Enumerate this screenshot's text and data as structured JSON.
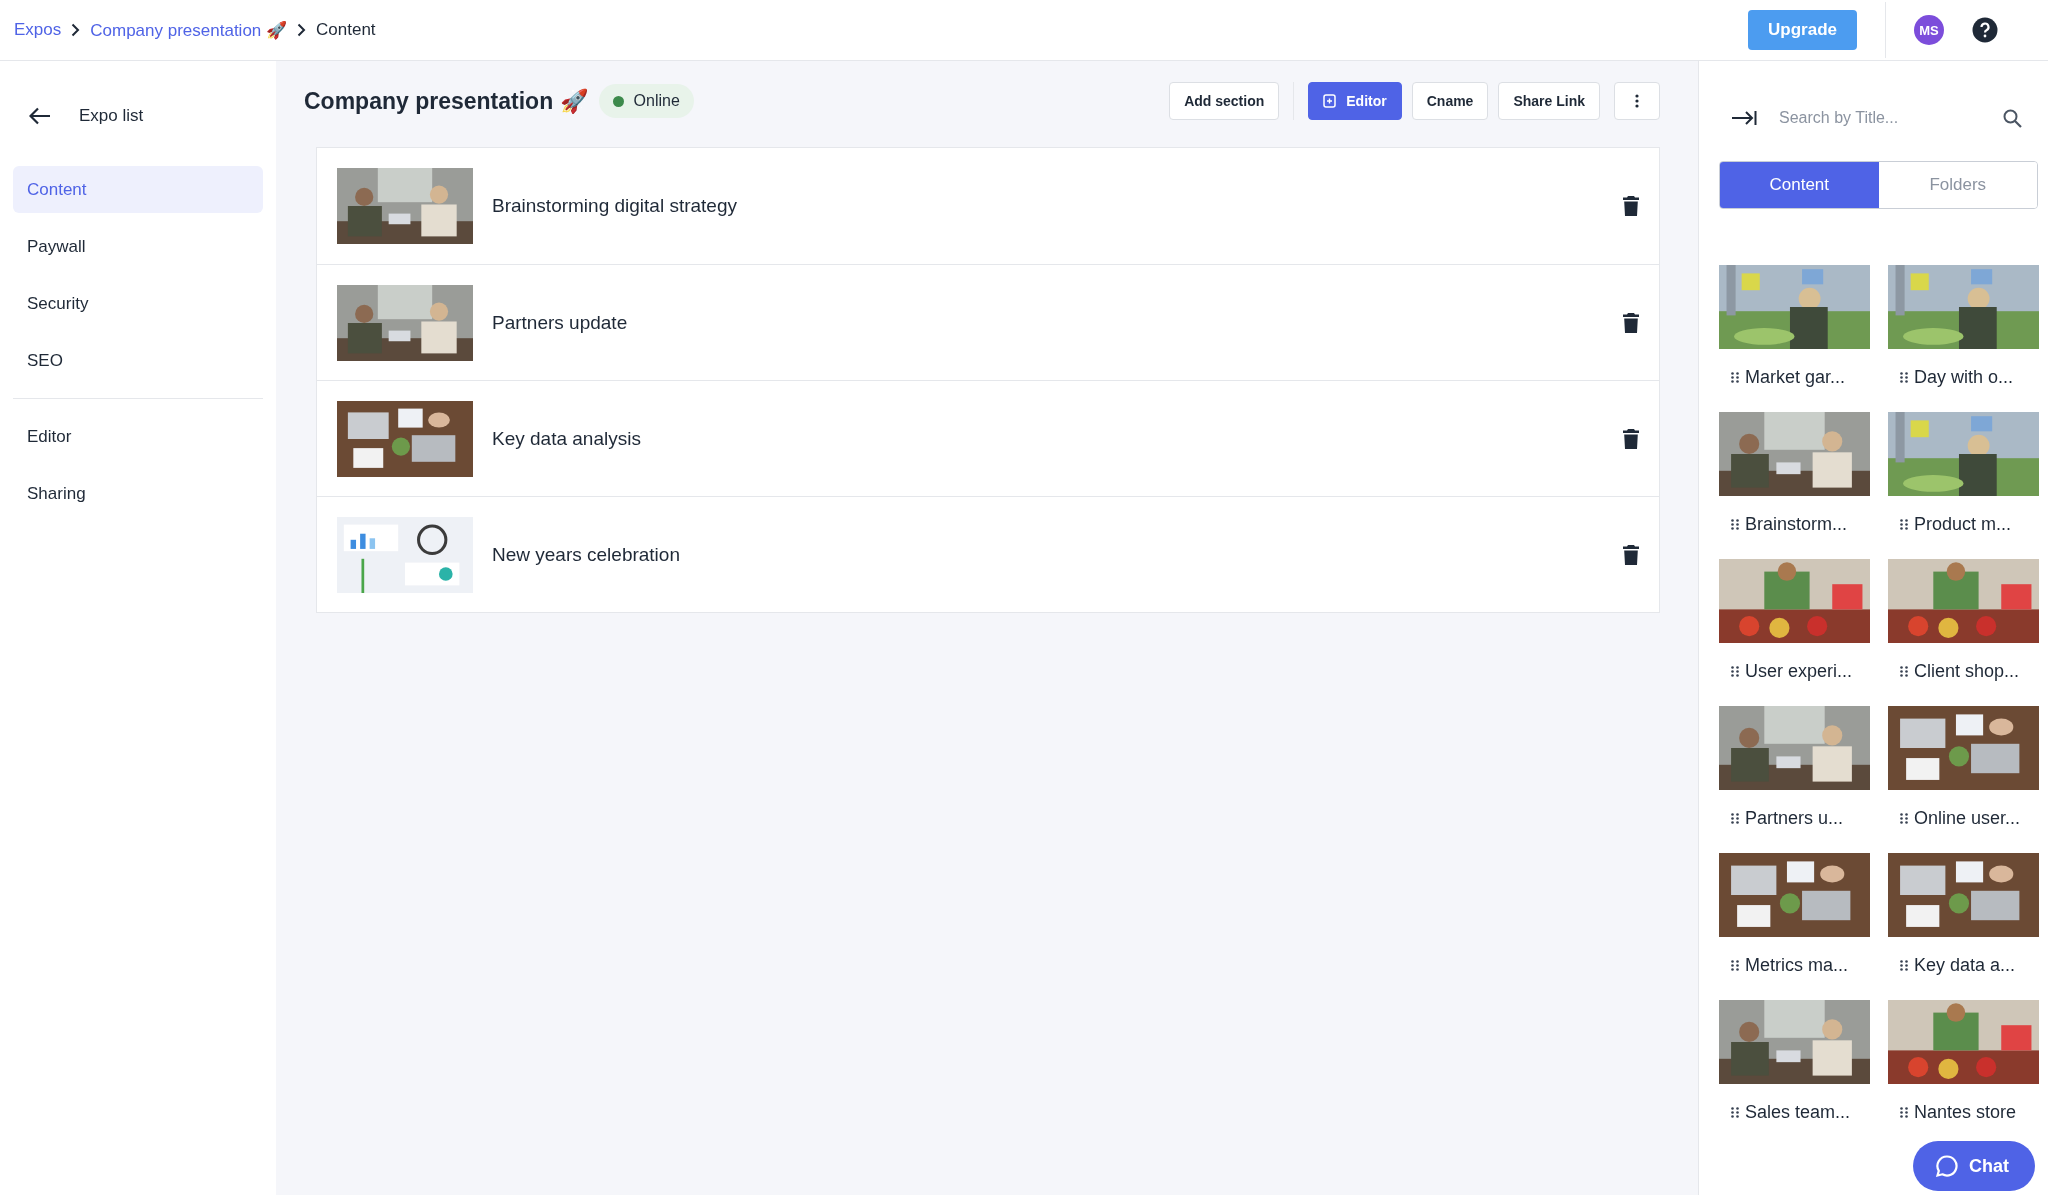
{
  "breadcrumb": [
    {
      "label": "Expos",
      "link": true
    },
    {
      "label": "Company presentation 🚀",
      "link": true
    },
    {
      "label": "Content",
      "link": false
    }
  ],
  "top_actions": {
    "upgrade": "Upgrade",
    "avatar": "MS"
  },
  "sidebar": {
    "back": "Expo list",
    "groups": [
      [
        {
          "label": "Content",
          "selected": true
        },
        {
          "label": "Paywall",
          "selected": false
        },
        {
          "label": "Security",
          "selected": false
        },
        {
          "label": "SEO",
          "selected": false
        }
      ],
      [
        {
          "label": "Editor",
          "selected": false
        },
        {
          "label": "Sharing",
          "selected": false
        }
      ]
    ]
  },
  "page": {
    "title": "Company presentation 🚀",
    "status": "Online"
  },
  "toolbar": [
    {
      "label": "Add section",
      "kind": "outline"
    },
    {
      "label": "Editor",
      "kind": "primary"
    },
    {
      "label": "Cname",
      "kind": "outline"
    },
    {
      "label": "Share Link",
      "kind": "outline"
    }
  ],
  "sections": [
    {
      "title": "Brainstorming digital strategy"
    },
    {
      "title": "Partners update"
    },
    {
      "title": "Key data analysis"
    },
    {
      "title": "New years celebration"
    }
  ],
  "library": {
    "search": {
      "placeholder": "Search by Title..."
    },
    "tabs": [
      {
        "label": "Content",
        "selected": true
      },
      {
        "label": "Folders",
        "selected": false
      }
    ],
    "items": [
      {
        "title": "Market gar..."
      },
      {
        "title": "Day with o..."
      },
      {
        "title": "Brainstorm..."
      },
      {
        "title": "Product m..."
      },
      {
        "title": "User experi..."
      },
      {
        "title": "Client shop..."
      },
      {
        "title": "Partners u..."
      },
      {
        "title": "Online user..."
      },
      {
        "title": "Metrics ma..."
      },
      {
        "title": "Key data a..."
      },
      {
        "title": "Sales team..."
      },
      {
        "title": "Nantes store"
      }
    ]
  },
  "chat": "Chat"
}
